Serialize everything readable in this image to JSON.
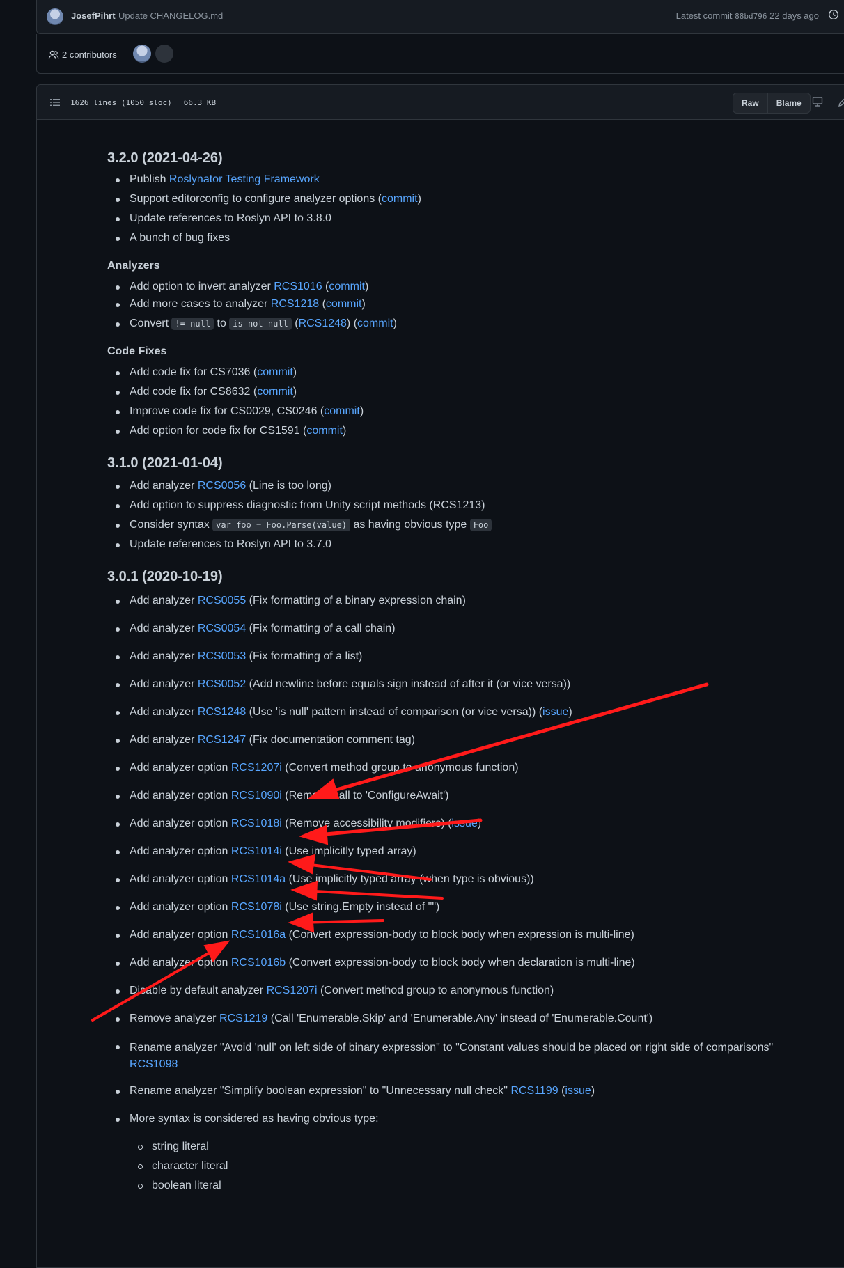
{
  "commit": {
    "author": "JosefPihrt",
    "message": "Update CHANGELOG.md",
    "latest_prefix": "Latest commit",
    "hash": "88bd796",
    "age": "22 days ago",
    "history_label": "H"
  },
  "contributors": {
    "count_label": "2 contributors"
  },
  "file": {
    "lines": "1626 lines (1050 sloc)",
    "size": "66.3 KB",
    "raw_label": "Raw",
    "blame_label": "Blame"
  },
  "sections": {
    "v320": {
      "heading": "3.2.0 (2021-04-26)",
      "items": {
        "i0": {
          "pre": "Publish ",
          "link": "Roslynator Testing Framework"
        },
        "i1": {
          "pre": "Support editorconfig to configure analyzer options (",
          "link": "commit",
          "post": ")"
        },
        "i2": {
          "text": "Update references to Roslyn API to 3.8.0"
        },
        "i3": {
          "text": "A bunch of bug fixes"
        }
      },
      "analyzers_heading": "Analyzers",
      "analyzers": {
        "a0": {
          "pre": "Add option to invert analyzer ",
          "link1": "RCS1016",
          "mid": " (",
          "link2": "commit",
          "post": ")"
        },
        "a1": {
          "pre": "Add more cases to analyzer ",
          "link1": "RCS1218",
          "mid": " (",
          "link2": "commit",
          "post": ")"
        },
        "a2": {
          "pre": "Convert ",
          "code1": "!= null",
          "mid1": " to ",
          "code2": "is not null",
          "mid2": " (",
          "link1": "RCS1248",
          "mid3": ") (",
          "link2": "commit",
          "post": ")"
        }
      },
      "codefixes_heading": "Code Fixes",
      "codefixes": {
        "c0": {
          "pre": "Add code fix for CS7036 (",
          "link": "commit",
          "post": ")"
        },
        "c1": {
          "pre": "Add code fix for CS8632 (",
          "link": "commit",
          "post": ")"
        },
        "c2": {
          "pre": "Improve code fix for CS0029, CS0246 (",
          "link": "commit",
          "post": ")"
        },
        "c3": {
          "pre": "Add option for code fix for CS1591 (",
          "link": "commit",
          "post": ")"
        }
      }
    },
    "v310": {
      "heading": "3.1.0 (2021-01-04)",
      "items": {
        "i0": {
          "pre": "Add analyzer ",
          "link": "RCS0056",
          "post": " (Line is too long)"
        },
        "i1": {
          "text": "Add option to suppress diagnostic from Unity script methods (RCS1213)"
        },
        "i2": {
          "pre": "Consider syntax ",
          "code1": "var foo = Foo.Parse(value)",
          "mid": " as having obvious type ",
          "code2": "Foo"
        },
        "i3": {
          "text": "Update references to Roslyn API to 3.7.0"
        }
      }
    },
    "v301": {
      "heading": "3.0.1 (2020-10-19)",
      "items": {
        "i0": {
          "pre": "Add analyzer ",
          "link": "RCS0055",
          "post": " (Fix formatting of a binary expression chain)"
        },
        "i1": {
          "pre": "Add analyzer ",
          "link": "RCS0054",
          "post": " (Fix formatting of a call chain)"
        },
        "i2": {
          "pre": "Add analyzer ",
          "link": "RCS0053",
          "post": " (Fix formatting of a list)"
        },
        "i3": {
          "pre": "Add analyzer ",
          "link": "RCS0052",
          "post": " (Add newline before equals sign instead of after it (or vice versa))"
        },
        "i4": {
          "pre": "Add analyzer ",
          "link": "RCS1248",
          "post": " (Use 'is null' pattern instead of comparison (or vice versa)) (",
          "link2": "issue",
          "post2": ")"
        },
        "i5": {
          "pre": "Add analyzer ",
          "link": "RCS1247",
          "post": " (Fix documentation comment tag)"
        },
        "i6": {
          "pre": "Add analyzer option ",
          "link": "RCS1207i",
          "post": " (Convert method group to anonymous function)"
        },
        "i7": {
          "pre": "Add analyzer option ",
          "link": "RCS1090i",
          "post": " (Remove call to 'ConfigureAwait')"
        },
        "i8": {
          "pre": "Add analyzer option ",
          "link": "RCS1018i",
          "post": " (Remove accessibility modifiers) (",
          "link2": "issue",
          "post2": ")"
        },
        "i9": {
          "pre": "Add analyzer option ",
          "link": "RCS1014i",
          "post": " (Use implicitly typed array)"
        },
        "i10": {
          "pre": "Add analyzer option ",
          "link": "RCS1014a",
          "post": " (Use implicitly typed array (when type is obvious))"
        },
        "i11": {
          "pre": "Add analyzer option ",
          "link": "RCS1078i",
          "post": " (Use string.Empty instead of \"\")"
        },
        "i12": {
          "pre": "Add analyzer option ",
          "link": "RCS1016a",
          "post": " (Convert expression-body to block body when expression is multi-line)"
        },
        "i13": {
          "pre": "Add analyzer option ",
          "link": "RCS1016b",
          "post": " (Convert expression-body to block body when declaration is multi-line)"
        },
        "i14": {
          "pre": "Disable by default analyzer ",
          "link": "RCS1207i",
          "post": " (Convert method group to anonymous function)"
        },
        "i15": {
          "pre": "Remove analyzer ",
          "link": "RCS1219",
          "post": " (Call 'Enumerable.Skip' and 'Enumerable.Any' instead of 'Enumerable.Count')"
        },
        "i16": {
          "pre": "Rename analyzer \"Avoid 'null' on left side of binary expression\" to \"Constant values should be placed on right side of comparisons\"",
          "link": "RCS1098"
        },
        "i17": {
          "pre": "Rename analyzer \"Simplify boolean expression\" to \"Unnecessary null check\" ",
          "link": "RCS1199",
          "mid": " (",
          "link2": "issue",
          "post2": ")"
        },
        "i18": {
          "text": "More syntax is considered as having obvious type:"
        }
      },
      "subitems": [
        "string literal",
        "character literal",
        "boolean literal"
      ]
    }
  },
  "annotation_color": "#ff1a1a"
}
